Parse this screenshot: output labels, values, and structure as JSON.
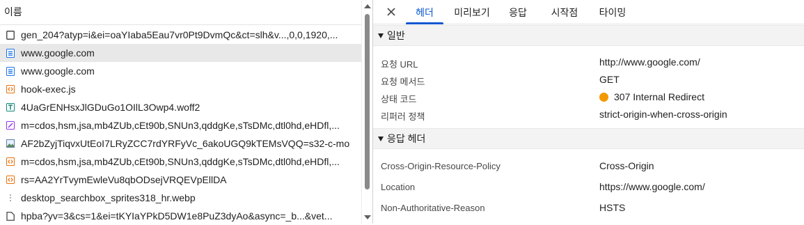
{
  "request_list": {
    "column_header": "이름",
    "rows": [
      {
        "name": "gen_204?atyp=i&ei=oaYIaba5Eau7vr0Pt9DvmQc&ct=slh&v...,0,0,1920,...",
        "type": "other"
      },
      {
        "name": "www.google.com",
        "type": "document",
        "selected": true
      },
      {
        "name": "www.google.com",
        "type": "document"
      },
      {
        "name": "hook-exec.js",
        "type": "script"
      },
      {
        "name": "4UaGrENHsxJlGDuGo1OIlL3Owp4.woff2",
        "type": "font"
      },
      {
        "name": "m=cdos,hsm,jsa,mb4ZUb,cEt90b,SNUn3,qddgKe,sTsDMc,dtl0hd,eHDfl,...",
        "type": "stylesheet"
      },
      {
        "name": "AF2bZyjTiqvxUtEoI7LRyZCC7rdYRFyVc_6akoUGQ9kTEMsVQQ=s32-c-mo",
        "type": "image"
      },
      {
        "name": "m=cdos,hsm,jsa,mb4ZUb,cEt90b,SNUn3,qddgKe,sTsDMc,dtl0hd,eHDfl,...",
        "type": "script"
      },
      {
        "name": "rs=AA2YrTvymEwleVu8qbODsejVRQEVpEllDA",
        "type": "script"
      },
      {
        "name": "desktop_searchbox_sprites318_hr.webp",
        "type": "image-pending"
      },
      {
        "name": "hpba?yv=3&cs=1&ei=tKYIaYPkD5DW1e8PuZ3dyAo&async=_b...&vet...",
        "type": "other"
      }
    ]
  },
  "details": {
    "tabs": [
      {
        "label": "헤더",
        "active": true
      },
      {
        "label": "미리보기"
      },
      {
        "label": "응답"
      },
      {
        "label": "시작점"
      },
      {
        "label": "타이밍"
      }
    ],
    "general": {
      "title": "일반",
      "request_url_label": "요청 URL",
      "request_url": "http://www.google.com/",
      "method_label": "요청 메서드",
      "method": "GET",
      "status_label": "상태 코드",
      "status": "307 Internal Redirect",
      "status_color": "#f29900",
      "referrer_label": "리퍼러 정책",
      "referrer": "strict-origin-when-cross-origin"
    },
    "response_headers": {
      "title": "응답 헤더",
      "items": [
        {
          "name": "Cross-Origin-Resource-Policy",
          "value": "Cross-Origin"
        },
        {
          "name": "Location",
          "value": "https://www.google.com/"
        },
        {
          "name": "Non-Authoritative-Reason",
          "value": "HSTS"
        }
      ]
    }
  },
  "colors": {
    "accent": "#0b57d0",
    "selected_row": "#e8e8e8"
  }
}
